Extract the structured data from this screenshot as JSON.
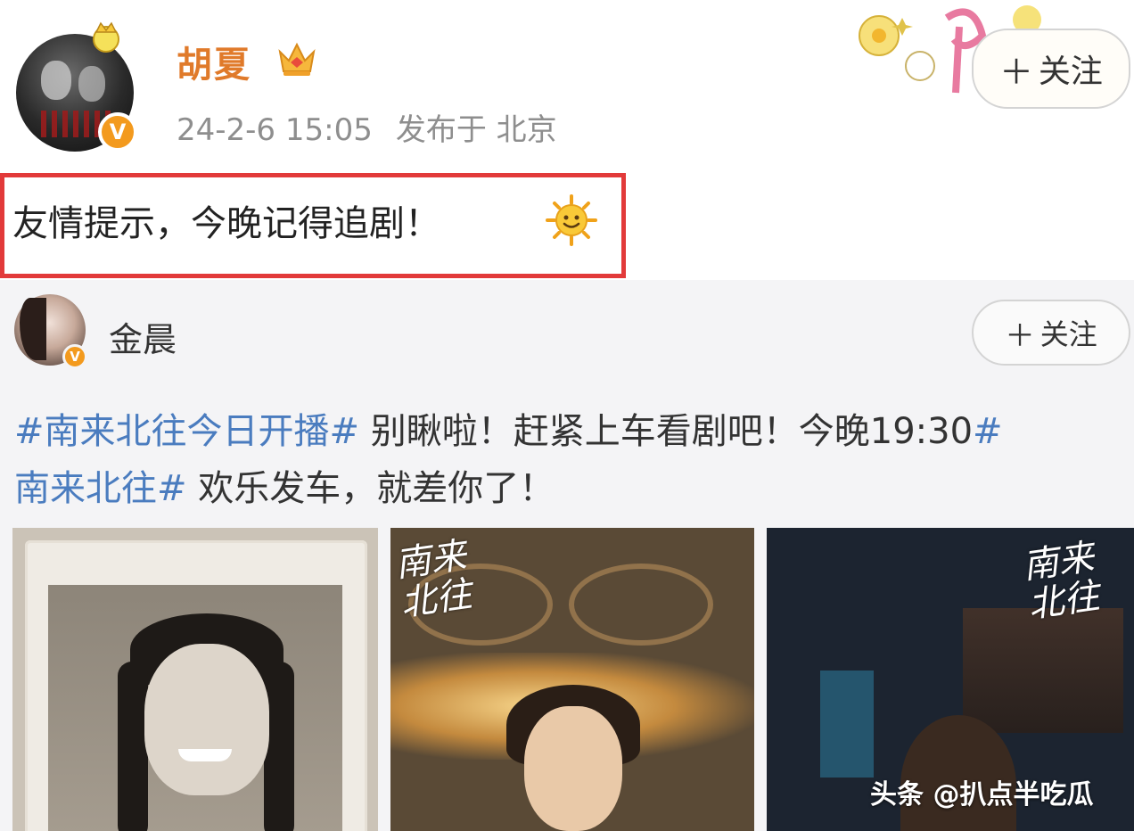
{
  "post": {
    "username": "胡夏",
    "timestamp": "24-2-6 15:05",
    "location": "发布于 北京",
    "follow_label": "关注",
    "text": "友情提示，今晚记得追剧！"
  },
  "repost": {
    "username": "金晨",
    "follow_label": "关注",
    "line1": [
      {
        "text": "#南来北往今日开播#",
        "tag": true
      },
      {
        "text": " 别瞅啦！赶紧上车看剧吧！今晚19:30",
        "tag": false
      },
      {
        "text": "#",
        "tag": true
      }
    ],
    "line2": [
      {
        "text": "南来北往#",
        "tag": true
      },
      {
        "text": " 欢乐发车，就差你了！",
        "tag": false
      }
    ],
    "images": [
      {
        "logo": ""
      },
      {
        "logo": "南来北往"
      },
      {
        "logo": "南来北往"
      }
    ]
  },
  "watermark": "头条 @扒点半吃瓜",
  "colors": {
    "username_orange": "#e07a2a",
    "tag_blue": "#4a7cbf",
    "highlight_red": "#e23a3a",
    "verify_orange": "#f39a1e"
  },
  "icons": [
    "avatar",
    "verified-badge-icon",
    "vip-crown-icon",
    "plus-icon",
    "sun-emoji-icon"
  ]
}
